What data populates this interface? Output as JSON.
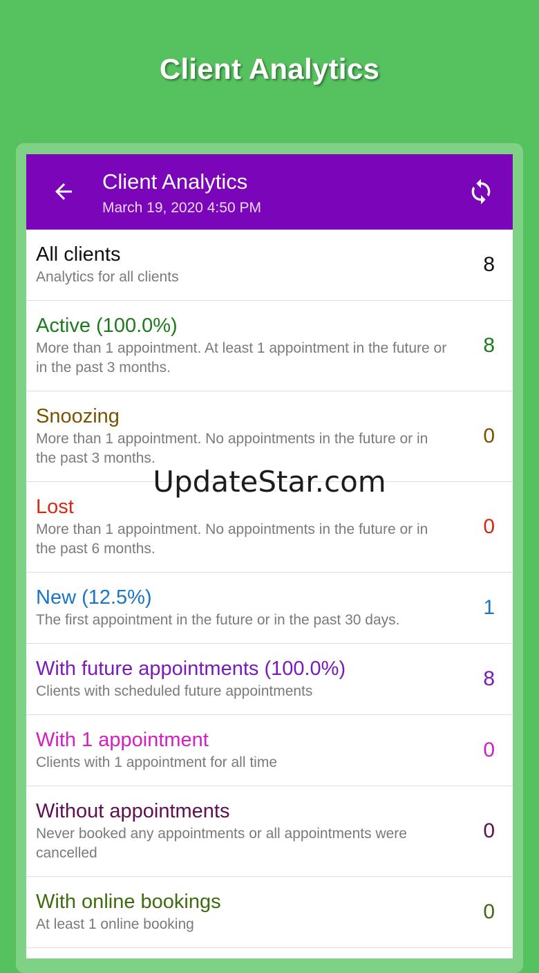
{
  "promo": {
    "title": "Client Analytics"
  },
  "app_bar": {
    "title": "Client Analytics",
    "subtitle": "March 19, 2020 4:50 PM",
    "color": "#7b05b8"
  },
  "watermark": "UpdateStar.com",
  "rows": [
    {
      "title": "All clients",
      "desc": "Analytics for all clients",
      "count": "8",
      "color": "#111111",
      "height": 103
    },
    {
      "title": "Active (100.0%)",
      "desc": "More than 1 appointment. At least 1 appointment in the future or in the past 3 months.",
      "count": "8",
      "color": "#1e7a1e",
      "height": 131
    },
    {
      "title": "Snoozing",
      "desc": "More than 1 appointment. No appointments in the future or in the past 3 months.",
      "count": "0",
      "color": "#7a5200",
      "height": 131
    },
    {
      "title": "Lost",
      "desc": "More than 1 appointment. No appointments in the future or in the past 6 months.",
      "count": "0",
      "color": "#d42a10",
      "height": 131
    },
    {
      "title": "New (12.5%)",
      "desc": "The first appointment in the future or in the past 30 days.",
      "count": "1",
      "color": "#1a74c8",
      "height": 103
    },
    {
      "title": "With future appointments (100.0%)",
      "desc": "Clients with scheduled future appointments",
      "count": "8",
      "color": "#7a1ab8",
      "height": 103
    },
    {
      "title": "With 1 appointment",
      "desc": "Clients with 1 appointment for all time",
      "count": "0",
      "color": "#d21fc1",
      "height": 103
    },
    {
      "title": "Without appointments",
      "desc": "Never booked any appointments or all appointments were cancelled",
      "count": "0",
      "color": "#5e0f4f",
      "height": 131
    },
    {
      "title": "With online bookings",
      "desc": "At least 1 online booking",
      "count": "0",
      "color": "#3d6b0e",
      "height": 103
    }
  ]
}
